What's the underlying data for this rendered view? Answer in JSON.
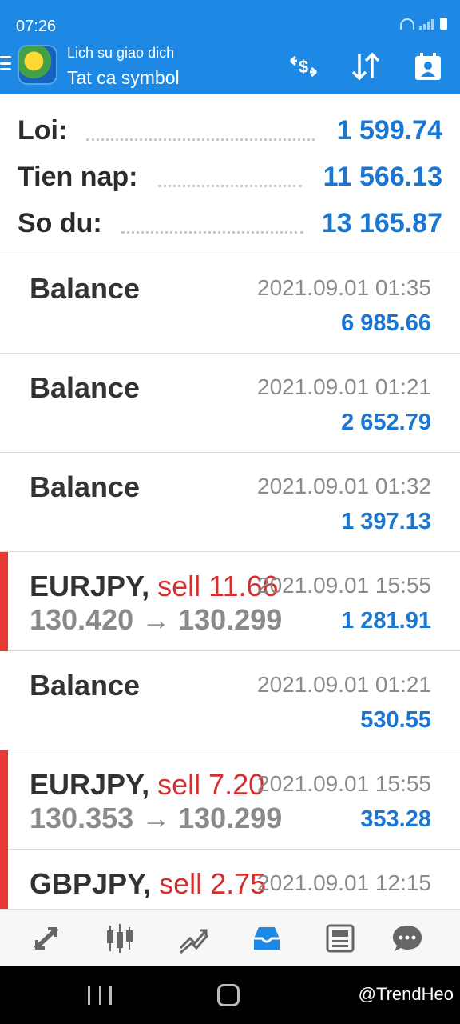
{
  "status_bar": {
    "time": "07:26"
  },
  "header": {
    "title": "Lich su giao dich",
    "subtitle": "Tat ca symbol",
    "actions": [
      "currency-exchange-icon",
      "sort-icon",
      "calendar-user-icon"
    ]
  },
  "summary": {
    "profit": {
      "label": "Loi:",
      "value": "1 599.74"
    },
    "deposit": {
      "label": "Tien nap:",
      "value": "11 566.13"
    },
    "balance": {
      "label": "So du:",
      "value": "13 165.87"
    }
  },
  "history": [
    {
      "title": "Balance",
      "date": "2021.09.01 01:35",
      "amount": "6 985.66"
    },
    {
      "title": "Balance",
      "date": "2021.09.01 01:21",
      "amount": "2 652.79"
    },
    {
      "title": "Balance",
      "date": "2021.09.01 01:32",
      "amount": "1 397.13"
    },
    {
      "title": "EURJPY,",
      "side": "sell 11.66",
      "date": "2021.09.01 15:55",
      "prices": "130.420 → 130.299",
      "amount": "1 281.91"
    },
    {
      "title": "Balance",
      "date": "2021.09.01 01:21",
      "amount": "530.55"
    },
    {
      "title": "EURJPY,",
      "side": "sell 7.20",
      "date": "2021.09.01 15:55",
      "prices": "130.353 → 130.299",
      "amount": "353.28"
    },
    {
      "title": "GBPJPY,",
      "side": "sell 2.75",
      "date": "2021.09.01 12:15",
      "prices": "",
      "amount": ""
    }
  ],
  "bottom_nav": [
    "quotes-icon",
    "chart-icon",
    "trade-icon",
    "history-icon",
    "news-icon",
    "chat-icon"
  ],
  "bottom_nav_active": "history-icon",
  "watermark": "@TrendHeo",
  "colors": {
    "accent": "#1e88e5",
    "value_blue": "#1976d2",
    "sell_red": "#d32f2f",
    "marker_red": "#e53935"
  }
}
